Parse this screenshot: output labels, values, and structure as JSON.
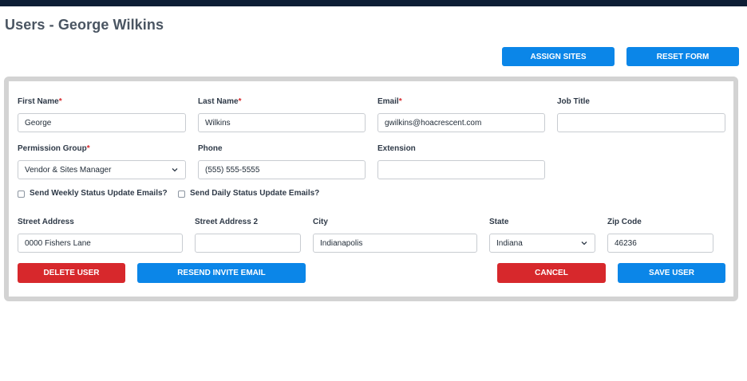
{
  "page": {
    "title": "Users - George Wilkins"
  },
  "actions": {
    "assign_sites": "ASSIGN SITES",
    "reset_form": "RESET FORM"
  },
  "form": {
    "first_name": {
      "label": "First Name",
      "required": "*",
      "value": "George"
    },
    "last_name": {
      "label": "Last Name",
      "required": "*",
      "value": "Wilkins"
    },
    "email": {
      "label": "Email",
      "required": "*",
      "value": "gwilkins@hoacrescent.com"
    },
    "job_title": {
      "label": "Job Title",
      "value": ""
    },
    "permission_group": {
      "label": "Permission Group",
      "required": "*",
      "value": "Vendor & Sites Manager"
    },
    "phone": {
      "label": "Phone",
      "value": "(555) 555-5555"
    },
    "extension": {
      "label": "Extension",
      "value": ""
    },
    "weekly_emails": {
      "label": "Send Weekly Status Update Emails?",
      "checked": false
    },
    "daily_emails": {
      "label": "Send Daily Status Update Emails?",
      "checked": false
    },
    "street_address": {
      "label": "Street Address",
      "value": "0000 Fishers Lane"
    },
    "street_address_2": {
      "label": "Street Address 2",
      "value": ""
    },
    "city": {
      "label": "City",
      "value": "Indianapolis"
    },
    "state": {
      "label": "State",
      "value": "Indiana"
    },
    "zip": {
      "label": "Zip Code",
      "value": "46236"
    }
  },
  "buttons": {
    "delete_user": "DELETE USER",
    "resend_invite": "RESEND INVITE EMAIL",
    "cancel": "CANCEL",
    "save_user": "SAVE USER"
  },
  "colors": {
    "primary": "#0b86e8",
    "danger": "#d7282c",
    "header": "#0d1e35",
    "card_border": "#d3d3d3"
  },
  "icons": {
    "select_arrow": "chevron-down-icon"
  }
}
